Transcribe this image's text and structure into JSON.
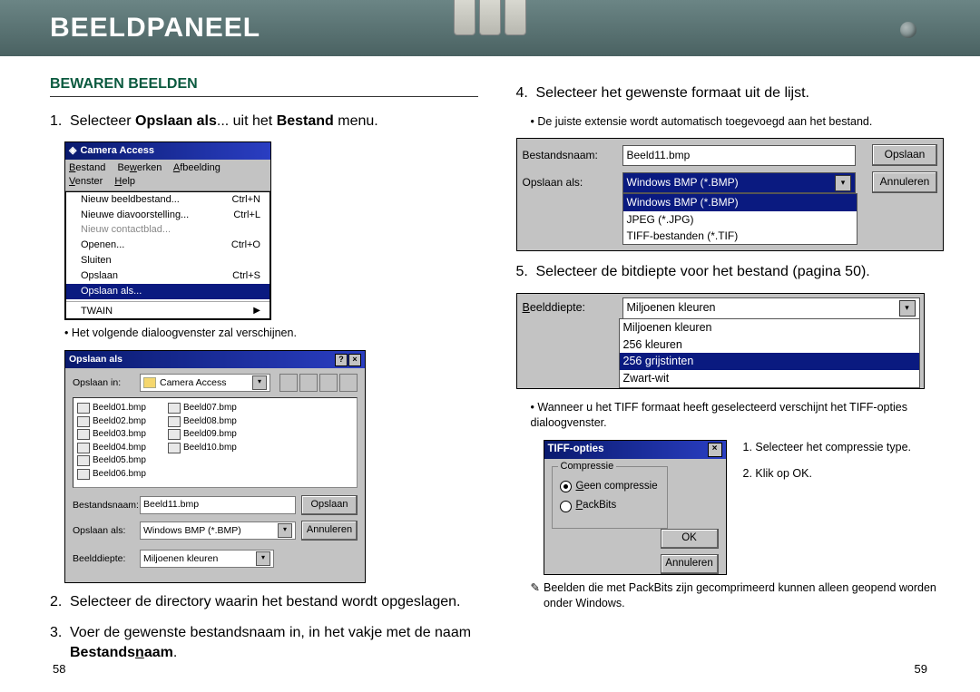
{
  "header": {
    "title": "BEELDPANEEL"
  },
  "left": {
    "section": "BEWAREN BEELDEN",
    "step1_pre": "Selecteer ",
    "step1_b1": "Opslaan als",
    "step1_mid": "... uit het ",
    "step1_b2": "Bestand",
    "step1_post": " menu.",
    "note1": "Het volgende dialoogvenster zal verschijnen.",
    "step2": "Selecteer de directory waarin het bestand wordt opgeslagen.",
    "step3_pre": "Voer de gewenste bestandsnaam in, in het vakje met de naam ",
    "step3_b": "Bestandsnaam",
    "step3_post": ".",
    "menu": {
      "title": "Camera Access",
      "bar": [
        "Bestand",
        "Bewerken",
        "Afbeelding",
        "Venster",
        "Help"
      ],
      "items": [
        {
          "label": "Nieuw beeldbestand...",
          "sc": "Ctrl+N"
        },
        {
          "label": "Nieuwe diavoorstelling...",
          "sc": "Ctrl+L"
        },
        {
          "label": "Nieuw contactblad...",
          "sc": "",
          "dis": true
        },
        {
          "label": "Openen...",
          "sc": "Ctrl+O"
        },
        {
          "label": "Sluiten",
          "sc": ""
        },
        {
          "label": "Opslaan",
          "sc": "Ctrl+S"
        },
        {
          "label": "Opslaan als...",
          "sc": "",
          "sel": true
        },
        {
          "label": "TWAIN",
          "sc": "▶",
          "sep": true
        }
      ]
    },
    "save": {
      "title": "Opslaan als",
      "loc_label": "Opslaan in:",
      "loc_value": "Camera Access",
      "files": [
        "Beeld01.bmp",
        "Beeld02.bmp",
        "Beeld03.bmp",
        "Beeld04.bmp",
        "Beeld05.bmp",
        "Beeld06.bmp",
        "Beeld07.bmp",
        "Beeld08.bmp",
        "Beeld09.bmp",
        "Beeld10.bmp"
      ],
      "fn_label": "Bestandsnaam:",
      "fn_value": "Beeld11.bmp",
      "type_label": "Opslaan als:",
      "type_value": "Windows BMP (*.BMP)",
      "depth_label": "Beelddiepte:",
      "depth_value": "Miljoenen kleuren",
      "btn_save": "Opslaan",
      "btn_cancel": "Annuleren"
    },
    "page": "58"
  },
  "right": {
    "step4": "Selecteer het gewenste formaat uit de lijst.",
    "note4": "De juiste extensie wordt automatisch toegevoegd aan het bestand.",
    "typebox": {
      "fn_label": "Bestandsnaam:",
      "fn_value": "Beeld11.bmp",
      "type_label": "Opslaan als:",
      "type_value": "Windows BMP (*.BMP)",
      "options": [
        "Windows BMP (*.BMP)",
        "JPEG (*.JPG)",
        "TIFF-bestanden (*.TIF)"
      ],
      "btn_save": "Opslaan",
      "btn_cancel": "Annuleren"
    },
    "step5": "Selecteer de bitdiepte voor het bestand (pagina 50).",
    "depthbox": {
      "label": "Beelddiepte:",
      "value": "Miljoenen kleuren",
      "options": [
        "Miljoenen kleuren",
        "256 kleuren",
        "256 grijstinten",
        "Zwart-wit"
      ]
    },
    "note_tiff": "Wanneer u het TIFF formaat heeft geselecteerd verschijnt het TIFF-opties dialoogvenster.",
    "tiff": {
      "title": "TIFF-opties",
      "group": "Compressie",
      "r1": "Geen compressie",
      "r2": "PackBits",
      "ok": "OK",
      "cancel": "Annuleren",
      "s1": "1. Selecteer het compressie type.",
      "s2": "2. Klik op OK."
    },
    "packbits_note": "Beelden die met PackBits zijn gecomprimeerd kunnen alleen geopend worden onder Windows.",
    "page": "59"
  }
}
